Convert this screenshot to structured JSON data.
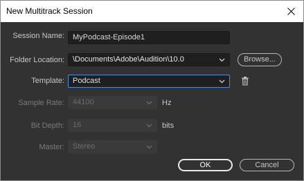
{
  "window": {
    "title": "New Multitrack Session"
  },
  "form": {
    "session_name": {
      "label": "Session Name:",
      "value": "MyPodcast-Episode1"
    },
    "folder_location": {
      "label": "Folder Location:",
      "value": "\\Documents\\Adobe\\Audition\\10.0",
      "browse_label": "Browse..."
    },
    "template": {
      "label": "Template:",
      "value": "Podcast"
    },
    "sample_rate": {
      "label": "Sample Rate:",
      "value": "44100",
      "unit": "Hz"
    },
    "bit_depth": {
      "label": "Bit Depth:",
      "value": "16",
      "unit": "bits"
    },
    "master": {
      "label": "Master:",
      "value": "Stereo"
    }
  },
  "buttons": {
    "ok": "OK",
    "cancel": "Cancel"
  },
  "icons": {
    "close": "close-icon",
    "chevron": "chevron-down-icon",
    "delete": "trash-icon"
  },
  "colors": {
    "focus_border": "#4b8fd6",
    "background": "#323232"
  }
}
